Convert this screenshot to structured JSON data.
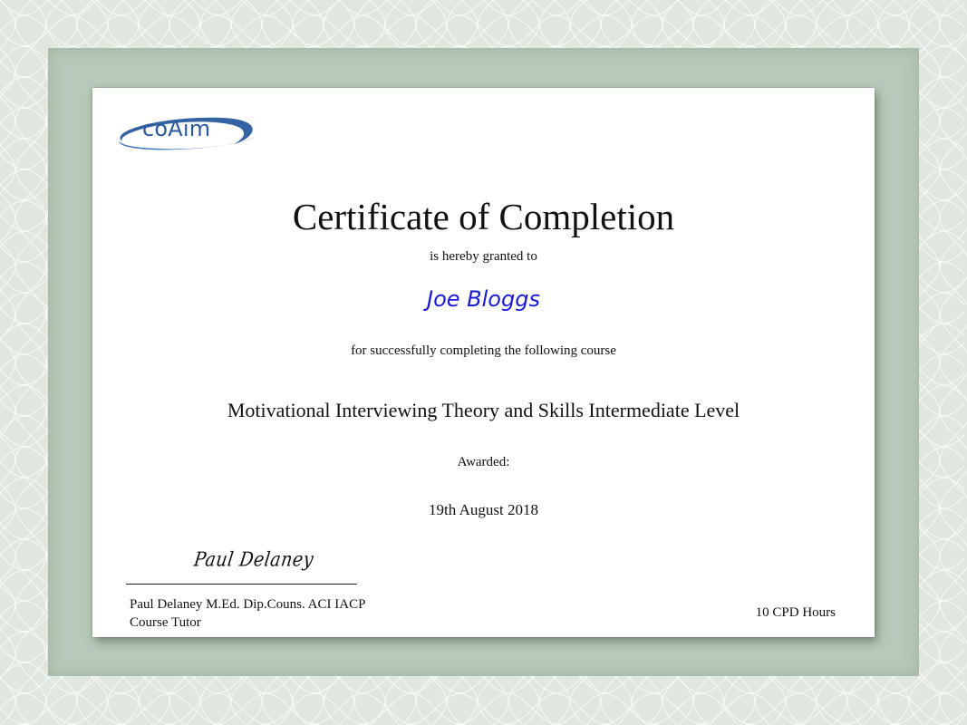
{
  "logo": {
    "text": "coAim",
    "ring_color": "#2a5a9e"
  },
  "certificate": {
    "title": "Certificate of Completion",
    "granted_text": "is hereby granted to",
    "recipient": "Joe Bloggs",
    "recipient_color": "#1a1ad6",
    "completing_text": "for successfully completing the following course",
    "course": "Motivational Interviewing Theory and Skills Intermediate Level",
    "awarded_label": "Awarded:",
    "awarded_date": "19th August 2018",
    "signature": "Paul Delaney",
    "tutor_name": "Paul Delaney M.Ed. Dip.Couns. ACI IACP",
    "tutor_role": "Course Tutor",
    "cpd_hours": "10 CPD Hours"
  },
  "colors": {
    "background": "#dfe7de",
    "mat": "#b7c9b8",
    "paper": "#ffffff"
  }
}
